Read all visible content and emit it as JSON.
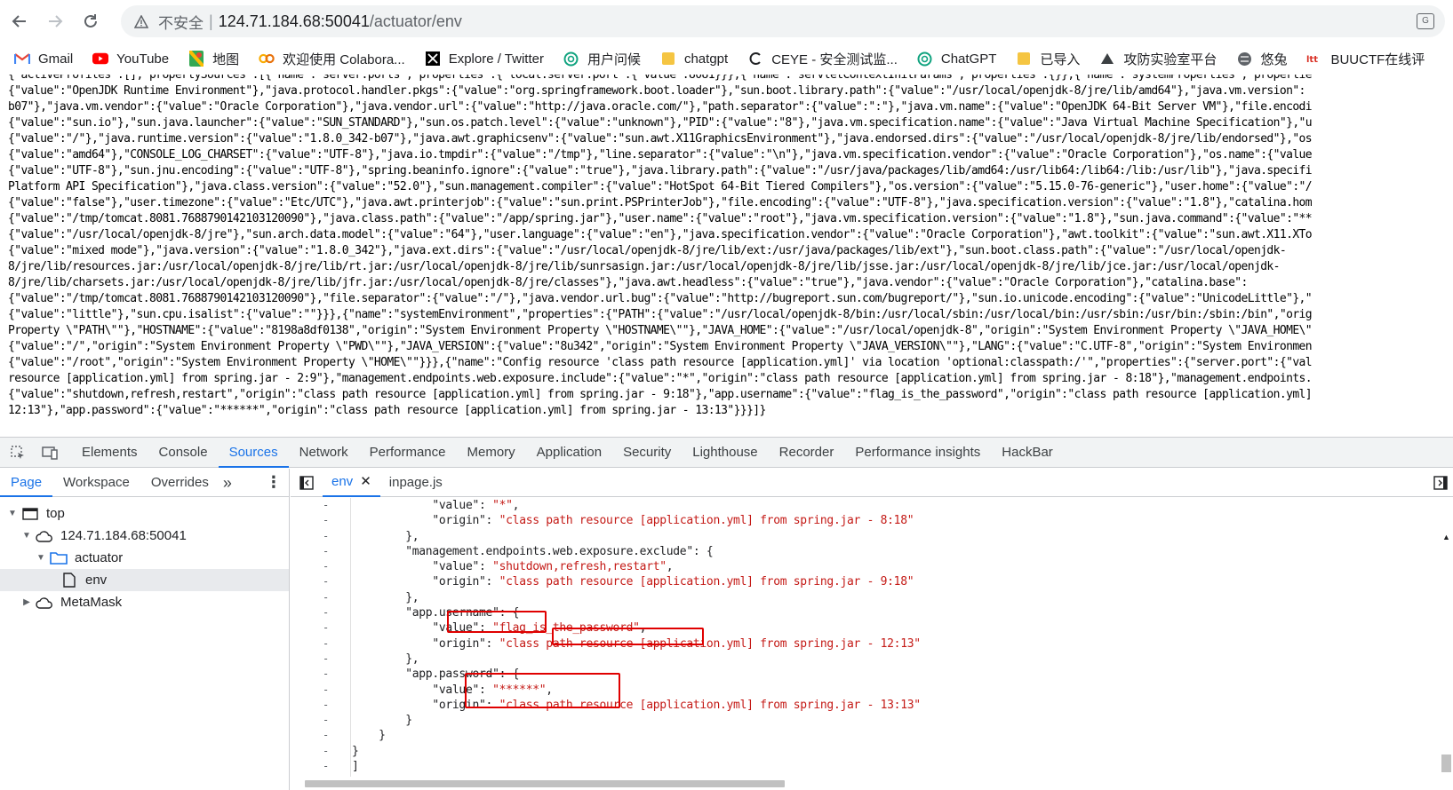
{
  "browser": {
    "insecure_label": "不安全",
    "separator": "|",
    "url_host": "124.71.184.68:50041",
    "url_path": "/actuator/env",
    "bookmarks": [
      {
        "label": "Gmail",
        "icon": "gmail-icon"
      },
      {
        "label": "YouTube",
        "icon": "youtube-icon"
      },
      {
        "label": "地图",
        "icon": "maps-icon"
      },
      {
        "label": "欢迎使用 Colabora...",
        "icon": "colab-icon"
      },
      {
        "label": "Explore / Twitter",
        "icon": "x-icon"
      },
      {
        "label": "用户问候",
        "icon": "openai-icon"
      },
      {
        "label": "chatgpt",
        "icon": "folder-icon"
      },
      {
        "label": "CEYE - 安全测试监...",
        "icon": "ceye-icon"
      },
      {
        "label": "ChatGPT",
        "icon": "openai-icon"
      },
      {
        "label": "已导入",
        "icon": "folder-icon"
      },
      {
        "label": "攻防实验室平台",
        "icon": "lab-icon"
      },
      {
        "label": "悠兔",
        "icon": "globe-icon"
      },
      {
        "label": "BUUCTF在线评",
        "icon": "buu-icon"
      }
    ]
  },
  "page_json_lines": [
    "{\"activeProfiles\":[],\"propertySources\":[{\"name\":\"server.ports\",\"properties\":{\"local.server.port\":{\"value\":8081}}},{\"name\":\"servletContextInitParams\",\"properties\":{}},{\"name\":\"systemProperties\",\"propertie",
    "{\"value\":\"OpenJDK Runtime Environment\"},\"java.protocol.handler.pkgs\":{\"value\":\"org.springframework.boot.loader\"},\"sun.boot.library.path\":{\"value\":\"/usr/local/openjdk-8/jre/lib/amd64\"},\"java.vm.version\":",
    "b07\"},\"java.vm.vendor\":{\"value\":\"Oracle Corporation\"},\"java.vendor.url\":{\"value\":\"http://java.oracle.com/\"},\"path.separator\":{\"value\":\":\"},\"java.vm.name\":{\"value\":\"OpenJDK 64-Bit Server VM\"},\"file.encodi",
    "{\"value\":\"sun.io\"},\"sun.java.launcher\":{\"value\":\"SUN_STANDARD\"},\"sun.os.patch.level\":{\"value\":\"unknown\"},\"PID\":{\"value\":\"8\"},\"java.vm.specification.name\":{\"value\":\"Java Virtual Machine Specification\"},\"u",
    "{\"value\":\"/\"},\"java.runtime.version\":{\"value\":\"1.8.0_342-b07\"},\"java.awt.graphicsenv\":{\"value\":\"sun.awt.X11GraphicsEnvironment\"},\"java.endorsed.dirs\":{\"value\":\"/usr/local/openjdk-8/jre/lib/endorsed\"},\"os",
    "{\"value\":\"amd64\"},\"CONSOLE_LOG_CHARSET\":{\"value\":\"UTF-8\"},\"java.io.tmpdir\":{\"value\":\"/tmp\"},\"line.separator\":{\"value\":\"\\n\"},\"java.vm.specification.vendor\":{\"value\":\"Oracle Corporation\"},\"os.name\":{\"value",
    "{\"value\":\"UTF-8\"},\"sun.jnu.encoding\":{\"value\":\"UTF-8\"},\"spring.beaninfo.ignore\":{\"value\":\"true\"},\"java.library.path\":{\"value\":\"/usr/java/packages/lib/amd64:/usr/lib64:/lib64:/lib:/usr/lib\"},\"java.specifi",
    "Platform API Specification\"},\"java.class.version\":{\"value\":\"52.0\"},\"sun.management.compiler\":{\"value\":\"HotSpot 64-Bit Tiered Compilers\"},\"os.version\":{\"value\":\"5.15.0-76-generic\"},\"user.home\":{\"value\":\"/",
    "{\"value\":\"false\"},\"user.timezone\":{\"value\":\"Etc/UTC\"},\"java.awt.printerjob\":{\"value\":\"sun.print.PSPrinterJob\"},\"file.encoding\":{\"value\":\"UTF-8\"},\"java.specification.version\":{\"value\":\"1.8\"},\"catalina.hom",
    "{\"value\":\"/tmp/tomcat.8081.7688790142103120090\"},\"java.class.path\":{\"value\":\"/app/spring.jar\"},\"user.name\":{\"value\":\"root\"},\"java.vm.specification.version\":{\"value\":\"1.8\"},\"sun.java.command\":{\"value\":\"**",
    "{\"value\":\"/usr/local/openjdk-8/jre\"},\"sun.arch.data.model\":{\"value\":\"64\"},\"user.language\":{\"value\":\"en\"},\"java.specification.vendor\":{\"value\":\"Oracle Corporation\"},\"awt.toolkit\":{\"value\":\"sun.awt.X11.XTo",
    "{\"value\":\"mixed mode\"},\"java.version\":{\"value\":\"1.8.0_342\"},\"java.ext.dirs\":{\"value\":\"/usr/local/openjdk-8/jre/lib/ext:/usr/java/packages/lib/ext\"},\"sun.boot.class.path\":{\"value\":\"/usr/local/openjdk-",
    "8/jre/lib/resources.jar:/usr/local/openjdk-8/jre/lib/rt.jar:/usr/local/openjdk-8/jre/lib/sunrsasign.jar:/usr/local/openjdk-8/jre/lib/jsse.jar:/usr/local/openjdk-8/jre/lib/jce.jar:/usr/local/openjdk-",
    "8/jre/lib/charsets.jar:/usr/local/openjdk-8/jre/lib/jfr.jar:/usr/local/openjdk-8/jre/classes\"},\"java.awt.headless\":{\"value\":\"true\"},\"java.vendor\":{\"value\":\"Oracle Corporation\"},\"catalina.base\":",
    "{\"value\":\"/tmp/tomcat.8081.7688790142103120090\"},\"file.separator\":{\"value\":\"/\"},\"java.vendor.url.bug\":{\"value\":\"http://bugreport.sun.com/bugreport/\"},\"sun.io.unicode.encoding\":{\"value\":\"UnicodeLittle\"},\"",
    "{\"value\":\"little\"},\"sun.cpu.isalist\":{\"value\":\"\"}}},{\"name\":\"systemEnvironment\",\"properties\":{\"PATH\":{\"value\":\"/usr/local/openjdk-8/bin:/usr/local/sbin:/usr/local/bin:/usr/sbin:/usr/bin:/sbin:/bin\",\"orig",
    "Property \\\"PATH\\\"\"},\"HOSTNAME\":{\"value\":\"8198a8df0138\",\"origin\":\"System Environment Property \\\"HOSTNAME\\\"\"},\"JAVA_HOME\":{\"value\":\"/usr/local/openjdk-8\",\"origin\":\"System Environment Property \\\"JAVA_HOME\\\"",
    "{\"value\":\"/\",\"origin\":\"System Environment Property \\\"PWD\\\"\"},\"JAVA_VERSION\":{\"value\":\"8u342\",\"origin\":\"System Environment Property \\\"JAVA_VERSION\\\"\"},\"LANG\":{\"value\":\"C.UTF-8\",\"origin\":\"System Environmen",
    "{\"value\":\"/root\",\"origin\":\"System Environment Property \\\"HOME\\\"\"}}},{\"name\":\"Config resource 'class path resource [application.yml]' via location 'optional:classpath:/'\",\"properties\":{\"server.port\":{\"val",
    "resource [application.yml] from spring.jar - 2:9\"},\"management.endpoints.web.exposure.include\":{\"value\":\"*\",\"origin\":\"class path resource [application.yml] from spring.jar - 8:18\"},\"management.endpoints.",
    "{\"value\":\"shutdown,refresh,restart\",\"origin\":\"class path resource [application.yml] from spring.jar - 9:18\"},\"app.username\":{\"value\":\"flag_is_the_password\",\"origin\":\"class path resource [application.yml]",
    "12:13\"},\"app.password\":{\"value\":\"******\",\"origin\":\"class path resource [application.yml] from spring.jar - 13:13\"}}}]}"
  ],
  "devtools": {
    "tabs": [
      "Elements",
      "Console",
      "Sources",
      "Network",
      "Performance",
      "Memory",
      "Application",
      "Security",
      "Lighthouse",
      "Recorder",
      "Performance insights",
      "HackBar"
    ],
    "active_tab": "Sources",
    "nav_tabs": [
      "Page",
      "Workspace",
      "Overrides"
    ],
    "nav_more": "»",
    "tree": {
      "top": "top",
      "host": "124.71.184.68:50041",
      "folder": "actuator",
      "file": "env",
      "extension": "MetaMask"
    },
    "file_tabs": [
      {
        "label": "env",
        "active": true
      },
      {
        "label": "inpage.js",
        "active": false
      }
    ],
    "gutter_mark": "-",
    "code_lines": [
      [
        {
          "t": "            ",
          "c": "p"
        },
        {
          "t": "\"value\"",
          "c": "k"
        },
        {
          "t": ": ",
          "c": "p"
        },
        {
          "t": "\"*\"",
          "c": "s"
        },
        {
          "t": ",",
          "c": "p"
        }
      ],
      [
        {
          "t": "            ",
          "c": "p"
        },
        {
          "t": "\"origin\"",
          "c": "k"
        },
        {
          "t": ": ",
          "c": "p"
        },
        {
          "t": "\"class path resource [application.yml] from spring.jar - 8:18\"",
          "c": "s"
        }
      ],
      [
        {
          "t": "        },",
          "c": "p"
        }
      ],
      [
        {
          "t": "        ",
          "c": "p"
        },
        {
          "t": "\"management.endpoints.web.exposure.exclude\"",
          "c": "k"
        },
        {
          "t": ": {",
          "c": "p"
        }
      ],
      [
        {
          "t": "            ",
          "c": "p"
        },
        {
          "t": "\"value\"",
          "c": "k"
        },
        {
          "t": ": ",
          "c": "p"
        },
        {
          "t": "\"shutdown,refresh,restart\"",
          "c": "s"
        },
        {
          "t": ",",
          "c": "p"
        }
      ],
      [
        {
          "t": "            ",
          "c": "p"
        },
        {
          "t": "\"origin\"",
          "c": "k"
        },
        {
          "t": ": ",
          "c": "p"
        },
        {
          "t": "\"class path resource [application.yml] from spring.jar - 9:18\"",
          "c": "s"
        }
      ],
      [
        {
          "t": "        },",
          "c": "p"
        }
      ],
      [
        {
          "t": "        ",
          "c": "p"
        },
        {
          "t": "\"app.username\"",
          "c": "k"
        },
        {
          "t": ": {",
          "c": "p"
        }
      ],
      [
        {
          "t": "            ",
          "c": "p"
        },
        {
          "t": "\"value\"",
          "c": "k"
        },
        {
          "t": ": ",
          "c": "p"
        },
        {
          "t": "\"flag_is_the_password\"",
          "c": "s"
        },
        {
          "t": ",",
          "c": "p"
        }
      ],
      [
        {
          "t": "            ",
          "c": "p"
        },
        {
          "t": "\"origin\"",
          "c": "k"
        },
        {
          "t": ": ",
          "c": "p"
        },
        {
          "t": "\"class path resource [application.yml] from spring.jar - 12:13\"",
          "c": "s"
        }
      ],
      [
        {
          "t": "        },",
          "c": "p"
        }
      ],
      [
        {
          "t": "        ",
          "c": "p"
        },
        {
          "t": "\"app.password\"",
          "c": "k"
        },
        {
          "t": ": {",
          "c": "p"
        }
      ],
      [
        {
          "t": "            ",
          "c": "p"
        },
        {
          "t": "\"value\"",
          "c": "k"
        },
        {
          "t": ": ",
          "c": "p"
        },
        {
          "t": "\"******\"",
          "c": "s"
        },
        {
          "t": ",",
          "c": "p"
        }
      ],
      [
        {
          "t": "            ",
          "c": "p"
        },
        {
          "t": "\"origin\"",
          "c": "k"
        },
        {
          "t": ": ",
          "c": "p"
        },
        {
          "t": "\"class path resource [application.yml] from spring.jar - 13:13\"",
          "c": "s"
        }
      ],
      [
        {
          "t": "        }",
          "c": "p"
        }
      ],
      [
        {
          "t": "    }",
          "c": "p"
        }
      ],
      [
        {
          "t": "}",
          "c": "p"
        }
      ],
      [
        {
          "t": "]",
          "c": "p"
        }
      ]
    ]
  },
  "colors": {
    "accent": "#1a73e8",
    "string": "#c41a16",
    "highlight_box": "#e00000"
  }
}
